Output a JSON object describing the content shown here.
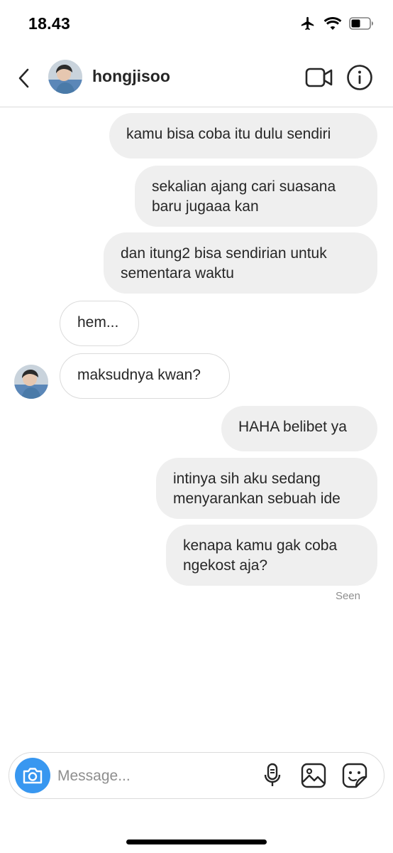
{
  "status_bar": {
    "time": "18.43",
    "icons": [
      "airplane-icon",
      "wifi-icon",
      "battery-icon"
    ]
  },
  "header": {
    "username": "hongjisoo",
    "icons": [
      "back-arrow-icon",
      "video-call-icon",
      "info-icon"
    ]
  },
  "messages": [
    {
      "direction": "out",
      "text": "kamu bisa coba itu dulu sendiri"
    },
    {
      "direction": "out",
      "text": "sekalian ajang cari suasana\nbaru jugaaa kan"
    },
    {
      "direction": "out",
      "text": "dan itung2 bisa sendirian untuk\nsementara waktu"
    },
    {
      "direction": "in",
      "text": "hem..."
    },
    {
      "direction": "in",
      "text": "maksudnya kwan?"
    },
    {
      "direction": "out",
      "text": "HAHA belibet ya"
    },
    {
      "direction": "out",
      "text": "intinya sih aku sedang\nmenyarankan sebuah ide"
    },
    {
      "direction": "out",
      "text": "kenapa kamu gak coba\nngekost aja?"
    }
  ],
  "seen_label": "Seen",
  "composer": {
    "placeholder": "Message...",
    "icons": [
      "camera-icon",
      "microphone-icon",
      "gallery-icon",
      "sticker-icon"
    ]
  },
  "colors": {
    "accent": "#3897f0",
    "outgoing_bubble": "#efefef",
    "border": "#dbdbdb",
    "muted_text": "#8e8e8e"
  }
}
